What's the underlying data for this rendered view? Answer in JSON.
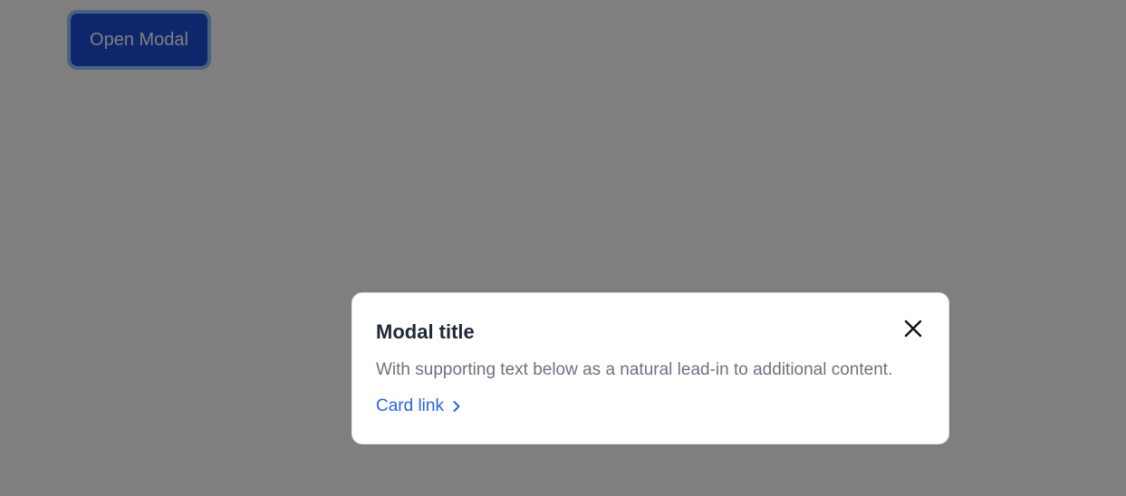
{
  "page": {
    "open_button_label": "Open Modal"
  },
  "modal": {
    "title": "Modal title",
    "text": "With supporting text below as a natural lead-in to additional content.",
    "link_label": "Card link",
    "close_icon": "close-icon",
    "link_icon": "chevron-right-icon"
  },
  "colors": {
    "primary": "#1d4ed8",
    "link": "#2563eb",
    "title": "#1f2937",
    "text": "#6b7280",
    "backdrop": "rgba(0,0,0,0.5)"
  }
}
